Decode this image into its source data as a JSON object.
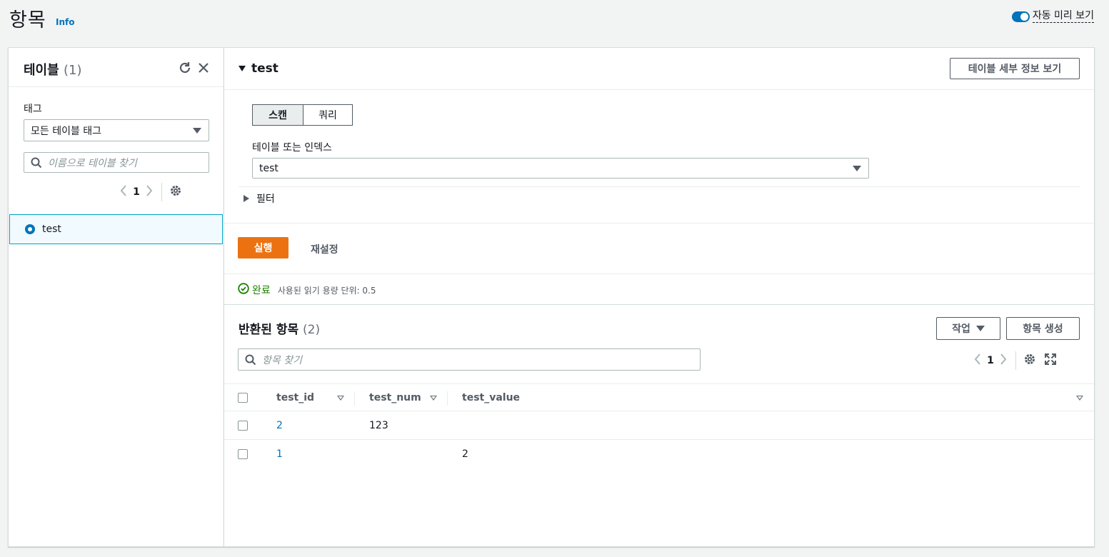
{
  "page": {
    "title": "항목",
    "info": "Info",
    "autopreview_label": "자동 미리 보기"
  },
  "tables_panel": {
    "title": "테이블",
    "count": "(1)",
    "tag_label": "태그",
    "tag_select": "모든 테이블 태그",
    "search_placeholder": "이름으로 테이블 찾기",
    "page": "1",
    "items": [
      {
        "name": "test",
        "selected": true
      }
    ]
  },
  "table_detail": {
    "title": "test",
    "details_button": "테이블 세부 정보 보기",
    "scan_tab": "스캔",
    "query_tab": "쿼리",
    "index_label": "테이블 또는 인덱스",
    "index_value": "test",
    "filter_label": "필터",
    "run_button": "실행",
    "reset_button": "재설정",
    "status": "완료",
    "status_detail": "사용된 읽기 용량 단위: 0.5"
  },
  "results": {
    "title": "반환된 항목",
    "count": "(2)",
    "actions_button": "작업",
    "create_button": "항목 생성",
    "search_placeholder": "항목 찾기",
    "page": "1",
    "columns": [
      "test_id",
      "test_num",
      "test_value"
    ],
    "rows": [
      {
        "test_id": "2",
        "test_num": "123",
        "test_value": ""
      },
      {
        "test_id": "1",
        "test_num": "",
        "test_value": "2"
      }
    ]
  },
  "colors": {
    "accent": "#0073bb",
    "primary_button": "#ec7211",
    "success": "#1d8102"
  }
}
